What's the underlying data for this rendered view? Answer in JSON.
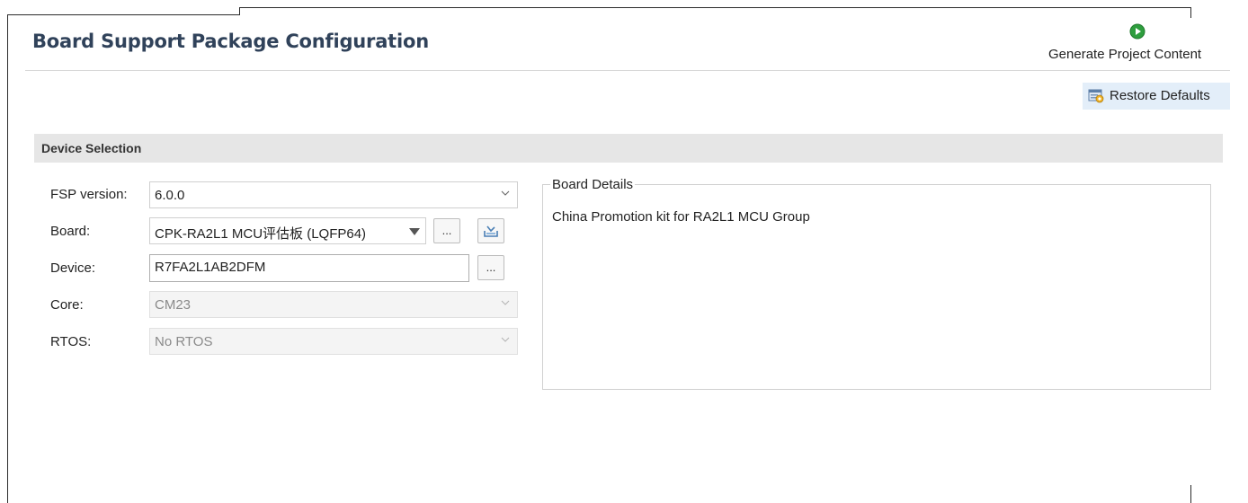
{
  "header": {
    "title": "Board Support Package Configuration",
    "generate_label": "Generate Project Content"
  },
  "toolbar": {
    "restore_label": "Restore Defaults"
  },
  "device_selection": {
    "title": "Device Selection",
    "fields": {
      "fsp_version": {
        "label": "FSP version:",
        "value": "6.0.0"
      },
      "board": {
        "label": "Board:",
        "value": "CPK-RA2L1 MCU评估板 (LQFP64)",
        "browse_label": "..."
      },
      "device": {
        "label": "Device:",
        "value": "R7FA2L1AB2DFM",
        "browse_label": "..."
      },
      "core": {
        "label": "Core:",
        "value": "CM23"
      },
      "rtos": {
        "label": "RTOS:",
        "value": "No RTOS"
      }
    }
  },
  "board_details": {
    "legend": "Board Details",
    "text": "China Promotion kit for RA2L1 MCU Group"
  },
  "colors": {
    "title": "#30425a",
    "section_bar": "#e6e6e6",
    "generate_icon": "#2e9e3e",
    "restore_hover": "#e3eef9"
  }
}
